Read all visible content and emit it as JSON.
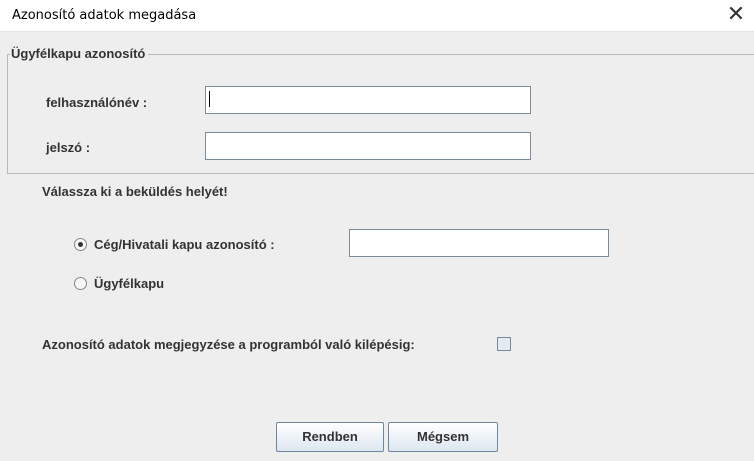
{
  "window": {
    "title": "Azonosító adatok megadása",
    "close_symbol": "✕"
  },
  "credentials": {
    "group_title": "Ügyfélkapu azonosító",
    "username_label": "felhasználónév :",
    "username_value": "",
    "password_label": "jelszó :",
    "password_value": ""
  },
  "destination": {
    "prompt": "Válassza ki a beküldés helyét!",
    "options": [
      {
        "label": "Cég/Hivatali kapu azonosító :",
        "selected": true
      },
      {
        "label": "Ügyfélkapu",
        "selected": false
      }
    ],
    "company_id_value": ""
  },
  "remember": {
    "label": "Azonosító adatok megjegyzése a programból való kilépésig:",
    "checked": false
  },
  "buttons": {
    "ok_label": "Rendben",
    "cancel_label": "Mégsem"
  }
}
